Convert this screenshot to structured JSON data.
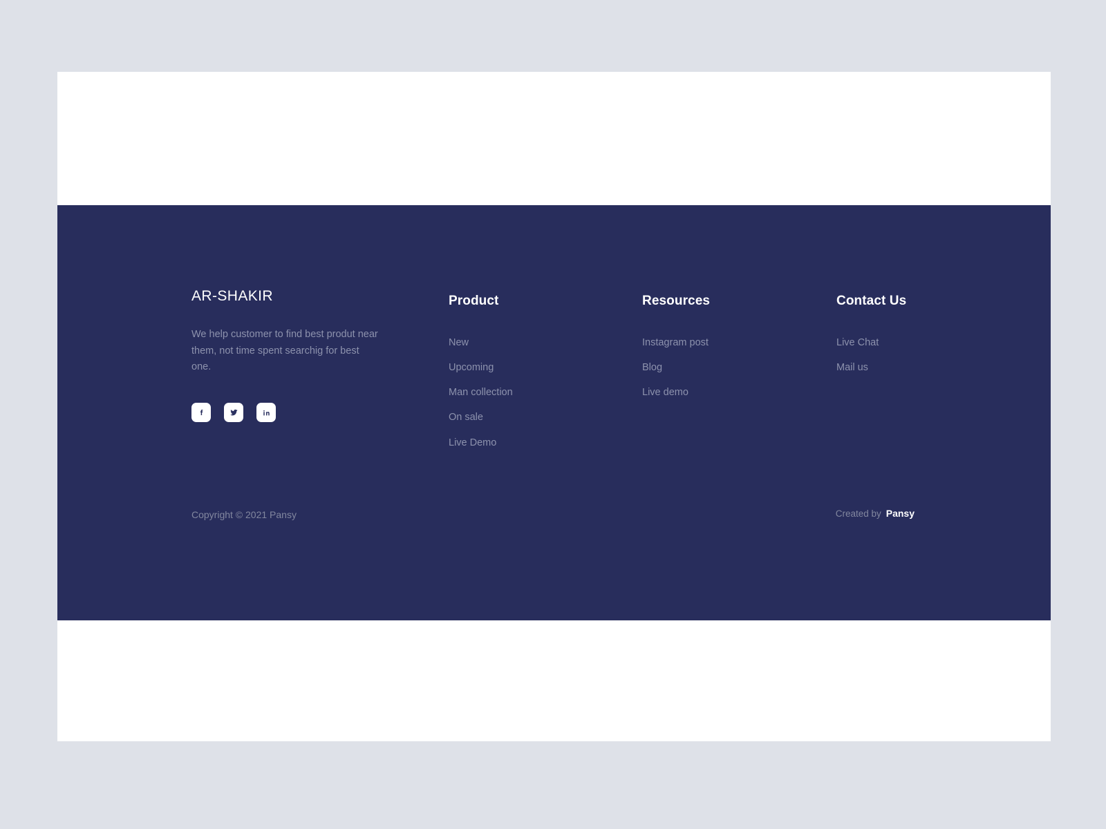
{
  "theme": {
    "page_background": "#dee1e8",
    "card_background": "#ffffff",
    "footer_background": "#282d5c",
    "heading_color": "#ffffff",
    "muted_text_color": "#8d92ad",
    "social_button_background": "#ffffff",
    "social_icon_color": "#2b3160"
  },
  "footer": {
    "brand": {
      "name": "AR-SHAKIR",
      "description": "We help customer  to find best produt near them, not time spent searchig for best one.",
      "socials": [
        {
          "icon": "facebook-icon",
          "label": "Facebook"
        },
        {
          "icon": "twitter-icon",
          "label": "Twitter"
        },
        {
          "icon": "linkedin-icon",
          "label": "LinkedIn"
        }
      ]
    },
    "columns": [
      {
        "heading": "Product",
        "links": [
          "New",
          "Upcoming",
          "Man collection",
          "On sale",
          "Live Demo"
        ]
      },
      {
        "heading": "Resources",
        "links": [
          "Instagram post",
          "Blog",
          "Live demo"
        ]
      },
      {
        "heading": "Contact Us",
        "links": [
          "Live Chat",
          "Mail us"
        ]
      }
    ],
    "bottom_bar": {
      "copyright": "Copyright © 2021 Pansy",
      "created_label": "Created by",
      "created_brand": "Pansy"
    }
  }
}
